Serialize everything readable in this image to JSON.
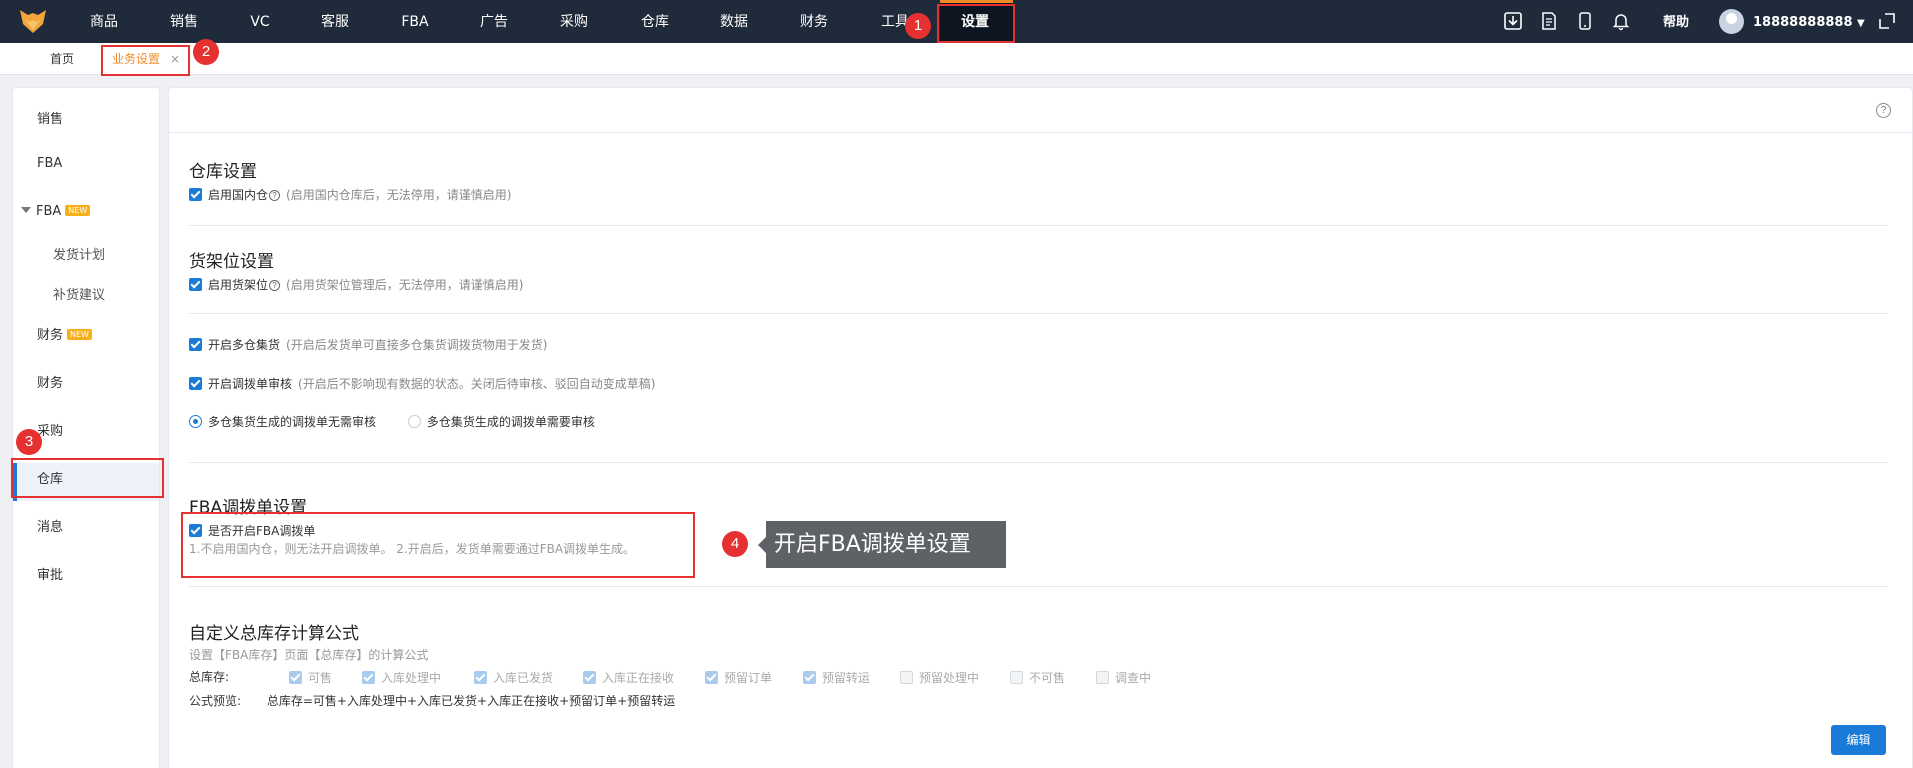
{
  "nav": {
    "items": [
      "商品",
      "销售",
      "VC",
      "客服",
      "FBA",
      "广告",
      "采购",
      "仓库",
      "数据",
      "财务",
      "工具",
      "设置"
    ],
    "help": "帮助",
    "user": "18888888888"
  },
  "badges": [
    "1",
    "2",
    "3",
    "4"
  ],
  "tabs": {
    "home": "首页",
    "active": "业务设置",
    "close": "×"
  },
  "sidebar": {
    "sales": "销售",
    "fba": "FBA",
    "fba_group": "FBA",
    "new_tag": "NEW",
    "ship_plan": "发货计划",
    "restock": "补货建议",
    "finance_new": "财务",
    "finance": "财务",
    "purchase": "采购",
    "warehouse": "仓库",
    "message": "消息",
    "approval": "审批"
  },
  "warehouse_section": {
    "title": "仓库设置",
    "enable_label": "启用国内仓",
    "enable_note": "(启用国内仓库后，无法停用，请谨慎启用)"
  },
  "shelf_section": {
    "title": "货架位设置",
    "enable_label": "启用货架位",
    "enable_note": "(启用货架位管理后，无法停用，请谨慎启用)"
  },
  "multi_section": {
    "multi_label": "开启多仓集货",
    "multi_note": "(开启后发货单可直接多仓集货调拨货物用于发货)",
    "review_label": "开启调拨单审核",
    "review_note": "(开启后不影响现有数据的状态。关闭后待审核、驳回自动变成草稿)",
    "radio_no_review": "多仓集货生成的调拨单无需审核",
    "radio_need_review": "多仓集货生成的调拨单需要审核"
  },
  "fba_section": {
    "title": "FBA调拨单设置",
    "enable_label": "是否开启FBA调拨单",
    "note": "1.不启用国内仓，则无法开启调拨单。 2.开启后，发货单需要通过FBA调拨单生成。"
  },
  "callout": "开启FBA调拨单设置",
  "formula_section": {
    "title": "自定义总库存计算公式",
    "desc": "设置【FBA库存】页面【总库存】的计算公式",
    "total_label": "总库存:",
    "options": [
      "可售",
      "入库处理中",
      "入库已发货",
      "入库正在接收",
      "预留订单",
      "预留转运",
      "预留处理中",
      "不可售",
      "调查中"
    ],
    "preview_label": "公式预览:",
    "preview_value": "总库存=可售+入库处理中+入库已发货+入库正在接收+预留订单+预留转运"
  },
  "edit_button": "编辑",
  "colors": {
    "accent": "#1a7ad8",
    "topbar": "#1f2a3a",
    "highlight": "#e5312f",
    "active_tab": "#f08c28"
  }
}
